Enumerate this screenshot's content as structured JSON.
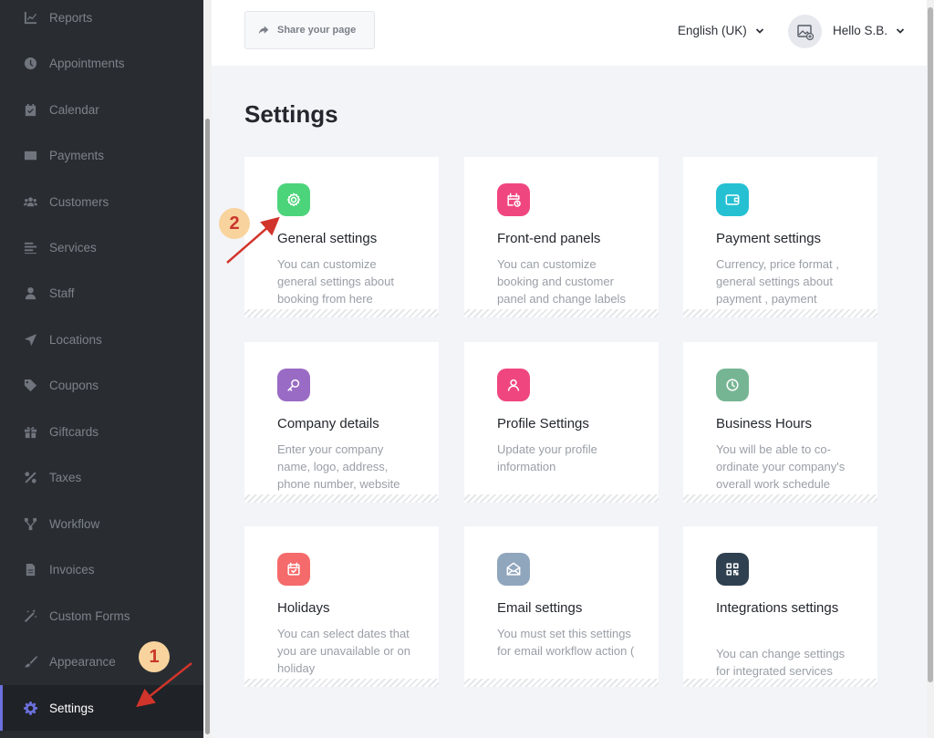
{
  "sidebar": {
    "items": [
      {
        "label": "Reports",
        "icon": "chart-icon"
      },
      {
        "label": "Appointments",
        "icon": "clock-icon"
      },
      {
        "label": "Calendar",
        "icon": "calendar-icon"
      },
      {
        "label": "Payments",
        "icon": "wallet-icon"
      },
      {
        "label": "Customers",
        "icon": "users-icon"
      },
      {
        "label": "Services",
        "icon": "list-icon"
      },
      {
        "label": "Staff",
        "icon": "user-icon"
      },
      {
        "label": "Locations",
        "icon": "location-arrow-icon"
      },
      {
        "label": "Coupons",
        "icon": "tag-icon"
      },
      {
        "label": "Giftcards",
        "icon": "gift-icon"
      },
      {
        "label": "Taxes",
        "icon": "percent-icon"
      },
      {
        "label": "Workflow",
        "icon": "workflow-icon"
      },
      {
        "label": "Invoices",
        "icon": "file-icon"
      },
      {
        "label": "Custom Forms",
        "icon": "magic-wand-icon"
      },
      {
        "label": "Appearance",
        "icon": "brush-icon"
      },
      {
        "label": "Settings",
        "icon": "gear-icon",
        "active": true
      }
    ]
  },
  "header": {
    "share_label": "Share your page",
    "language": "English (UK)",
    "user_greeting": "Hello S.B."
  },
  "page": {
    "title": "Settings"
  },
  "cards": [
    {
      "title": "General settings",
      "desc": "You can customize general settings about booking from here",
      "icon": "gear-icon",
      "color": "#4cd47b"
    },
    {
      "title": "Front-end panels",
      "desc": "You can customize booking and customer panel and change labels",
      "icon": "calendar-clock-icon",
      "color": "#f0467f"
    },
    {
      "title": "Payment settings",
      "desc": "Currency, price format , general settings about payment , payment",
      "icon": "wallet-icon",
      "color": "#26c0d3"
    },
    {
      "title": "Company details",
      "desc": "Enter your company name, logo, address, phone number, website",
      "icon": "key-icon",
      "color": "#9a6bc4"
    },
    {
      "title": "Profile Settings",
      "desc": "Update your profile information",
      "icon": "user-icon",
      "color": "#f0467f"
    },
    {
      "title": "Business Hours",
      "desc": "You will be able to co-ordinate your company's overall work schedule",
      "icon": "clock-icon",
      "color": "#76b593"
    },
    {
      "title": "Holidays",
      "desc": "You can select dates that you are unavailable or on holiday",
      "icon": "calendar-check-icon",
      "color": "#f56a6a"
    },
    {
      "title": "Email settings",
      "desc": "You must set this settings for email workflow action (",
      "icon": "envelope-open-icon",
      "color": "#90a6bd"
    },
    {
      "title": "Integrations settings",
      "desc": "You can change settings for integrated services",
      "icon": "qr-code-icon",
      "color": "#2f4050"
    }
  ],
  "annotations": {
    "step1": "1",
    "step2": "2",
    "badge_color": "#f8d39d",
    "arrow_color": "#d1342b"
  }
}
